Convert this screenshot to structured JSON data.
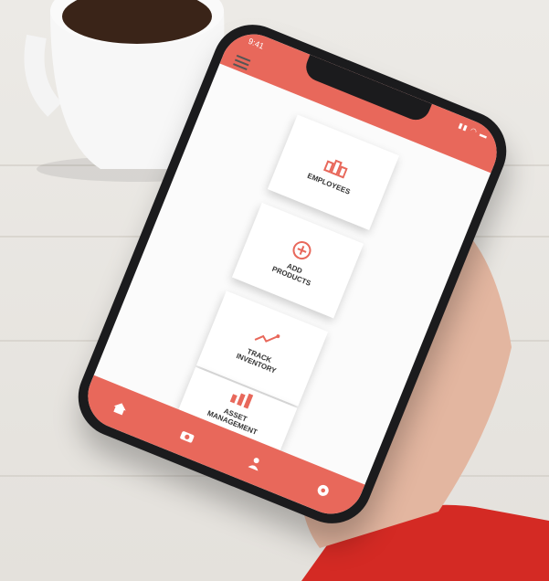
{
  "status_bar": {
    "time": "9:41",
    "icons": "signal wifi battery"
  },
  "header": {
    "menu_icon": "hamburger-menu-icon"
  },
  "cards": [
    {
      "label": "EMPLOYEES",
      "icon": "employees-icon"
    },
    {
      "label": "ADD\nPRODUCTS",
      "icon": "add-icon"
    },
    {
      "label": "TRACK\nINVENTORY",
      "icon": "trend-icon"
    },
    {
      "label": "ASSET\nMANAGEMENT",
      "icon": "asset-icon"
    }
  ],
  "bottom_nav": [
    {
      "icon": "home-icon"
    },
    {
      "icon": "camera-icon"
    },
    {
      "icon": "user-icon"
    },
    {
      "icon": "settings-icon"
    }
  ],
  "colors": {
    "accent": "#e8685b",
    "sleeve": "#d42a24"
  }
}
